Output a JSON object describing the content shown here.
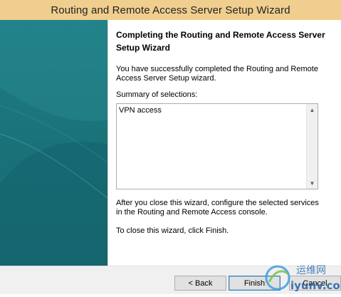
{
  "window": {
    "title": "Routing and Remote Access Server Setup Wizard"
  },
  "page": {
    "heading": "Completing the Routing and Remote Access Server Setup Wizard",
    "intro": "You have successfully completed the Routing and Remote Access Server Setup wizard.",
    "summary_label": "Summary of selections:",
    "summary_items": [
      "VPN access"
    ],
    "after_text": "After you close this wizard, configure the selected services in the Routing and  Remote Access console.",
    "close_note": "To close this wizard, click Finish."
  },
  "buttons": {
    "back": "< Back",
    "finish": "Finish",
    "cancel": "Cancel"
  },
  "watermark": {
    "top": "运维网",
    "bottom": "iyunv.com"
  },
  "colors": {
    "titlebar": "#f0ce8e",
    "side_panel": "#1a7178"
  }
}
